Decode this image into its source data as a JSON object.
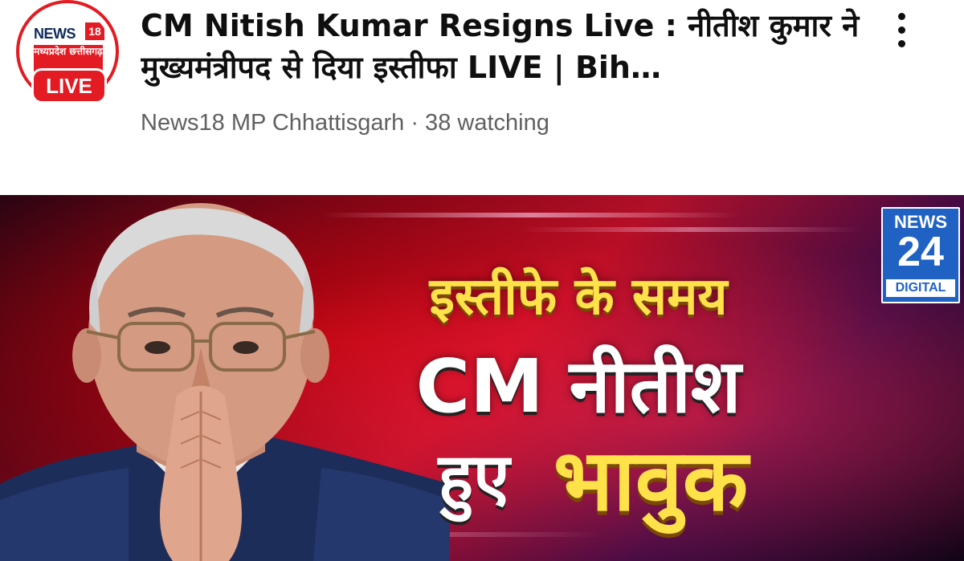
{
  "channel": {
    "avatar_brand": "NEWS",
    "avatar_brand_num": "18",
    "avatar_region": "मध्यप्रदेश छत्तीसगढ़",
    "live_badge": "LIVE",
    "name": "News18 MP Chhattisgarh",
    "meta": "News18 MP Chhattisgarh · 38 watching"
  },
  "video": {
    "title": "CM Nitish Kumar Resigns Live : नीतीश कुमार ने मुख्यमंत्रीपद से दिया इस्तीफा LIVE | Bih…"
  },
  "thumbnail": {
    "logo_news": "NEWS",
    "logo_num": "24",
    "logo_digital": "DIGITAL",
    "headline_line1": "इस्तीफे के समय",
    "headline_line2": "CM नीतीश",
    "headline_line3a": "हुए",
    "headline_line3b": "भावुक"
  },
  "colors": {
    "brand_red": "#e31b23",
    "headline_yellow": "#ffe14a",
    "news24_blue": "#1f62c4",
    "meta_gray": "#606060"
  }
}
